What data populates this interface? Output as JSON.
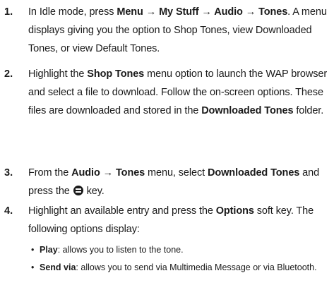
{
  "steps": [
    {
      "number": "1.",
      "parts": [
        "In Idle mode, press ",
        "Menu",
        " → ",
        "My Stuff",
        " → ",
        "Audio",
        " → ",
        "Tones",
        ". A menu displays giving you the option to Shop Tones, view Downloaded Tones, or view Default Tones."
      ]
    },
    {
      "number": "2.",
      "parts": [
        "Highlight the ",
        "Shop Tones",
        " menu option to launch the WAP browser and select a file to download. Follow the on-screen options. These files are downloaded and stored in the ",
        "Downloaded Tones",
        " folder."
      ]
    },
    {
      "number": "3.",
      "parts": [
        "From the ",
        "Audio",
        " → ",
        "Tones",
        " menu, select ",
        "Downloaded Tones",
        " and press the ",
        " key."
      ]
    },
    {
      "number": "4.",
      "parts": [
        "Highlight an available entry and press the ",
        "Options",
        " soft key. The following options display:"
      ]
    }
  ],
  "bullets": [
    {
      "term": "Play",
      "desc": ": allows you to listen to the tone."
    },
    {
      "term": "Send via",
      "desc": ": allows you to send via Multimedia Message or via Bluetooth."
    }
  ],
  "icons": {
    "key_icon": "center-select-key-icon"
  }
}
